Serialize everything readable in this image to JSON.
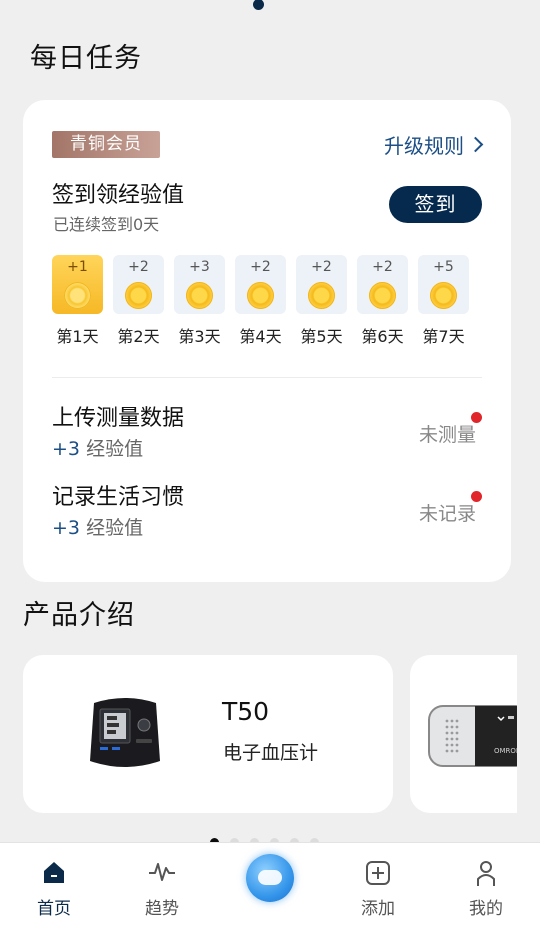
{
  "daily": {
    "title": "每日任务",
    "member_badge": "青铜会员",
    "upgrade_link": "升级规则",
    "signin_title": "签到领经验值",
    "signin_sub": "已连续签到0天",
    "signin_button": "签到",
    "days": [
      {
        "points": "+1",
        "label": "第1天",
        "active": true
      },
      {
        "points": "+2",
        "label": "第2天"
      },
      {
        "points": "+3",
        "label": "第3天"
      },
      {
        "points": "+2",
        "label": "第4天"
      },
      {
        "points": "+2",
        "label": "第5天"
      },
      {
        "points": "+2",
        "label": "第6天"
      },
      {
        "points": "+5",
        "label": "第7天"
      }
    ],
    "tasks": [
      {
        "title": "上传测量数据",
        "exp_num": "+3",
        "exp_text": "经验值",
        "status": "未测量"
      },
      {
        "title": "记录生活习惯",
        "exp_num": "+3",
        "exp_text": "经验值",
        "status": "未记录"
      }
    ]
  },
  "products": {
    "title": "产品介绍",
    "items": [
      {
        "name": "T50",
        "desc": "电子血压计"
      }
    ],
    "second_card_brand": "OMRON",
    "pager_count": 6,
    "pager_active": 0
  },
  "tabbar": {
    "tabs": [
      {
        "label": "首页",
        "icon": "home-icon"
      },
      {
        "label": "趋势",
        "icon": "trend-icon"
      },
      {
        "label": "",
        "icon": "chat-bubble-icon"
      },
      {
        "label": "添加",
        "icon": "add-icon"
      },
      {
        "label": "我的",
        "icon": "user-icon"
      }
    ]
  },
  "colors": {
    "primary": "#062a4d",
    "accent": "#1c4f86",
    "alert": "#e0252b"
  }
}
